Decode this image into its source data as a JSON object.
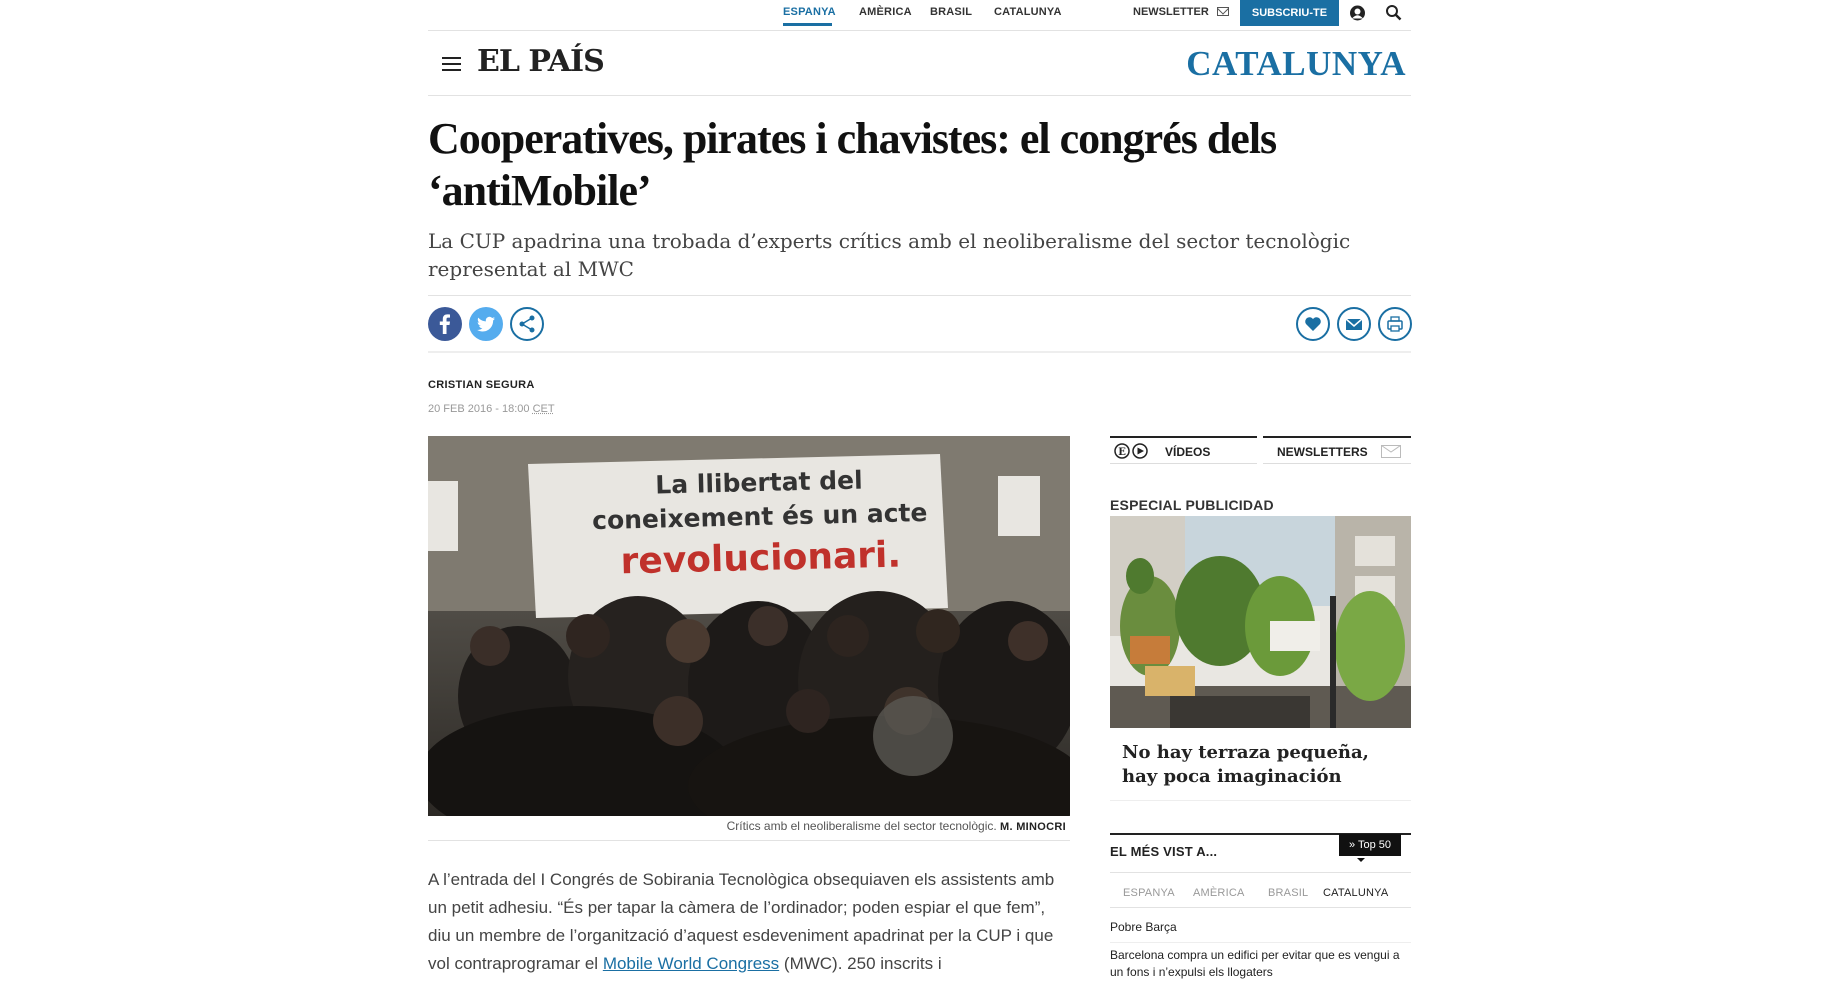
{
  "top_nav": {
    "editions": [
      "ESPANYA",
      "AMÈRICA",
      "BRASIL",
      "CATALUNYA"
    ],
    "active_edition": "ESPANYA",
    "newsletter_label": "NEWSLETTER",
    "subscribe_label": "SUBSCRIU-TE"
  },
  "masthead": {
    "logo_text": "EL PAÍS",
    "section": "CATALUNYA"
  },
  "article": {
    "headline": "Cooperatives, pirates i chavistes: el congrés dels ‘antiMobile’",
    "subheadline": "La CUP apadrina una trobada d’experts crítics amb el neoliberalisme del sector tecnològic representat al MWC",
    "author": "CRISTIAN SEGURA",
    "date": "20 FEB 2016 - 18:00",
    "timezone": "CET",
    "photo": {
      "banner_lines": [
        "La llibertat del",
        "coneixement és un acte",
        "revolucionari."
      ],
      "caption": "Crítics amb el neoliberalisme del sector tecnològic.",
      "credit": "M. MINOCRI"
    },
    "body_before_link": "A l’entrada del I Congrés de Sobirania Tecnològica obsequiaven els assistents amb un petit adhesiu. “És per tapar la càmera de l’ordinador; poden espiar el que fem”, diu un membre de l’organització d’aquest esdeveniment apadrinat per la CUP i que vol contraprogramar el ",
    "body_link": "Mobile World Congress",
    "body_after_link": " (MWC). 250 inscrits i"
  },
  "sidebar": {
    "tab_videos": "VÍDEOS",
    "tab_newsletters": "NEWSLETTERS",
    "especial_label": "ESPECIAL PUBLICIDAD",
    "ad_title": "No hay terraza pequeña, hay poca imaginación",
    "most_viewed": {
      "title": "EL MÉS VIST A...",
      "top50_label": "» Top 50",
      "tabs": [
        "ESPANYA",
        "AMÈRICA",
        "BRASIL",
        "CATALUNYA"
      ],
      "active_tab": "CATALUNYA",
      "items": [
        "Pobre Barça",
        "Barcelona compra un edifici per evitar que es vengui a un fons i n’expulsi els llogaters"
      ]
    }
  },
  "colors": {
    "brand_blue": "#1a6fa3",
    "facebook": "#3b5998",
    "twitter": "#55acee"
  },
  "icons": [
    "mail-icon",
    "user-icon",
    "search-icon",
    "hamburger-icon",
    "facebook-icon",
    "twitter-icon",
    "share-icon",
    "favorite-icon",
    "email-icon",
    "print-icon",
    "play-icon"
  ]
}
